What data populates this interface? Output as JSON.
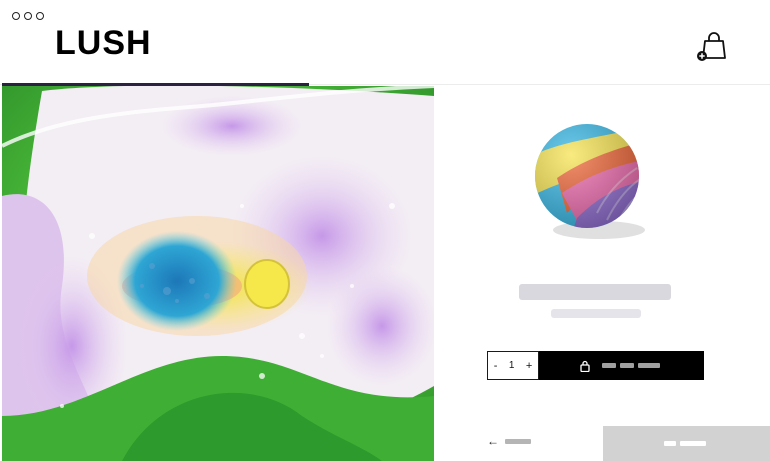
{
  "header": {
    "logo": "LUSH",
    "cart_icon": "shopping-bag-plus-icon"
  },
  "progress": {
    "fraction": 0.4
  },
  "product": {
    "image_icon": "bath-bomb-image",
    "title": "",
    "subtitle": ""
  },
  "stepper": {
    "minus": "-",
    "quantity": "1",
    "plus": "+"
  },
  "add_button": {
    "icon": "lock-icon",
    "label": ""
  },
  "nav": {
    "back_arrow": "←",
    "back_label": "",
    "next_label": ""
  },
  "colors": {
    "accent": "#2b2140",
    "button": "#000000",
    "next_button": "#d2d2d2"
  }
}
